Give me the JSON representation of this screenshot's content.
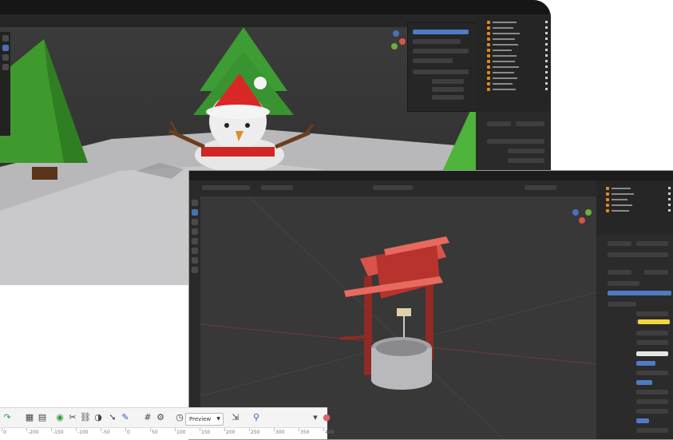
{
  "toolbar": {
    "preview_label": "Preview",
    "icons": [
      "redo-icon",
      "film-icon",
      "film-stack-icon",
      "record-icon",
      "knife-icon",
      "link-icon",
      "snap-icon",
      "select-arrow-icon",
      "pen-icon",
      "grid-icon",
      "gear-icon",
      "clock-icon",
      "arrow-icon",
      "zoom-icon",
      "dropdown-icon",
      "record-dot-icon"
    ],
    "ruler_ticks": [
      "0",
      "-200",
      "-150",
      "-100",
      "-50",
      "0",
      "50",
      "100",
      "150",
      "200",
      "250",
      "300",
      "350",
      "400"
    ]
  },
  "colors": {
    "accent_blue": "#4772b3",
    "outliner_orange": "#e38a1f",
    "tree_green": "#3e9a2d",
    "roof_red": "#d9534a",
    "well_stone": "#b9b9bd",
    "post_red": "#8f2a25",
    "material_yellow": "#f2d53c"
  }
}
